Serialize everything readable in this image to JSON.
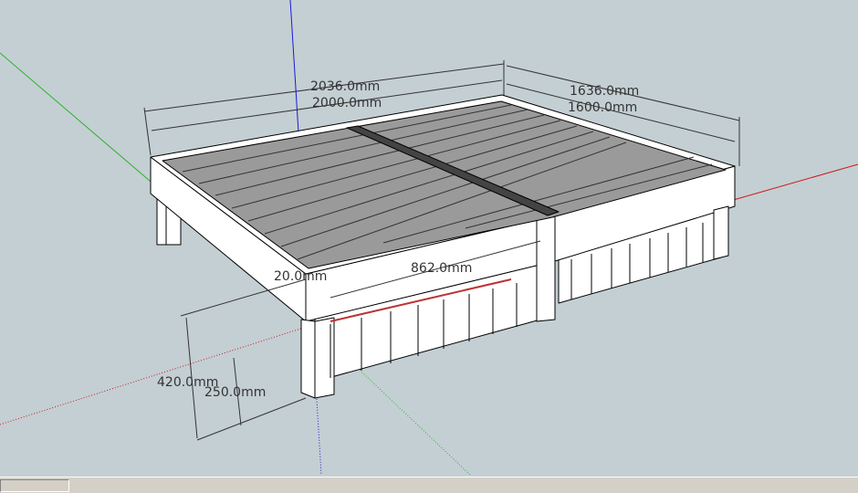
{
  "app": {
    "status_text": ""
  },
  "dimensions": {
    "outer_length": "2036.0mm",
    "inner_length": "2000.0mm",
    "outer_width": "1636.0mm",
    "inner_width": "1600.0mm",
    "module_width": "862.0mm",
    "thickness": "20.0mm",
    "overall_height": "420.0mm",
    "leg_height": "250.0mm"
  },
  "colors": {
    "background": "#c4cfd3",
    "axis_blue": "#1a1ad9",
    "axis_green": "#2db32d",
    "axis_red": "#cc1a1a",
    "slat_fill": "#9a9a9a",
    "frame_fill": "#ffffff"
  }
}
